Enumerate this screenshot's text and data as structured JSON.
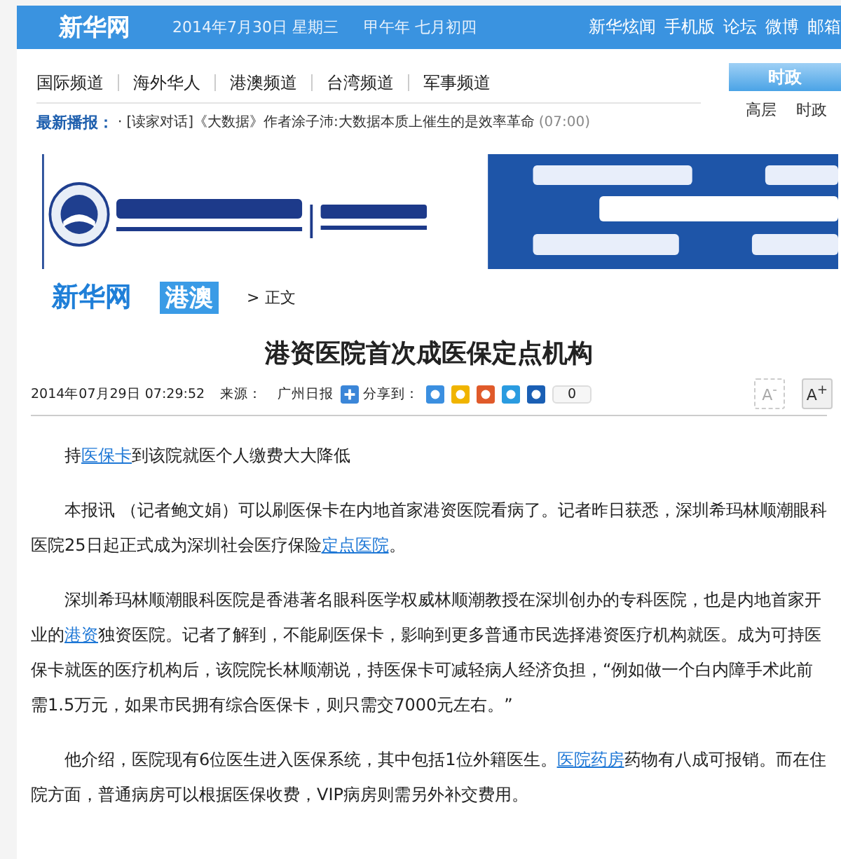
{
  "top_bar": {
    "logo": "新华网",
    "date": "2014年7月30日  星期三",
    "lunar": "甲午年  七月初四",
    "links": [
      "新华炫闻",
      "手机版",
      "论坛",
      "微博",
      "邮箱"
    ]
  },
  "channels": [
    "国际频道",
    "海外华人",
    "港澳频道",
    "台湾频道",
    "军事频道"
  ],
  "breaking": {
    "label": "最新播报：",
    "bullet": "·",
    "text": "[读家对话]《大数据》作者涂子沛:大数据本质上催生的是效率革命",
    "time": "(07:00)"
  },
  "side_panel": {
    "tabs": [
      {
        "label": "时政",
        "selected": true
      }
    ],
    "links": [
      "高层",
      "时政"
    ]
  },
  "section": {
    "logo": "新华网",
    "channel": "港澳",
    "separator": ">",
    "crumb": "正文"
  },
  "article": {
    "title": "港资医院首次成医保定点机构",
    "datetime": "2014年07月29日  07:29:52",
    "source_label": "来源：",
    "source": "广州日报",
    "share_label": "分享到：",
    "share_count": "0",
    "font_buttons": [
      {
        "label": "A$^{-}$",
        "disabled": true
      },
      {
        "label": "A$^{+}$",
        "disabled": false
      }
    ],
    "paragraphs": [
      [
        {
          "text": "持",
          "link": false
        },
        {
          "text": "医保卡",
          "link": true
        },
        {
          "text": "到该院就医个人缴费大大降低",
          "link": false
        }
      ],
      [
        {
          "text": "本报讯 （记者鲍文娟）可以刷医保卡在内地首家港资医院看病了。记者昨日获悉，深圳希玛林顺潮眼科医院25日起正式成为深圳社会医疗保险",
          "link": false
        },
        {
          "text": "定点医院",
          "link": true
        },
        {
          "text": "。",
          "link": false
        }
      ],
      [
        {
          "text": "深圳希玛林顺潮眼科医院是香港著名眼科医学权威林顺潮教授在深圳创办的专科医院，也是内地首家开业的",
          "link": false
        },
        {
          "text": "港资",
          "link": true
        },
        {
          "text": "独资医院。记者了解到，不能刷医保卡，影响到更多普通市民选择港资医疗机构就医。成为可持医保卡就医的医疗机构后，该院院长林顺潮说，持医保卡可减轻病人经济负担，“例如做一个白内障手术此前需1.5万元，如果市民拥有综合医保卡，则只需交7000元左右。”",
          "link": false
        }
      ],
      [
        {
          "text": "他介绍，医院现有6位医生进入医保系统，其中包括1位外籍医生。",
          "link": false
        },
        {
          "text": "医院药房",
          "link": true
        },
        {
          "text": "药物有八成可报销。而在住院方面，普通病房可以根据医保收费，VIP病房则需另外补交费用。",
          "link": false
        }
      ]
    ]
  }
}
